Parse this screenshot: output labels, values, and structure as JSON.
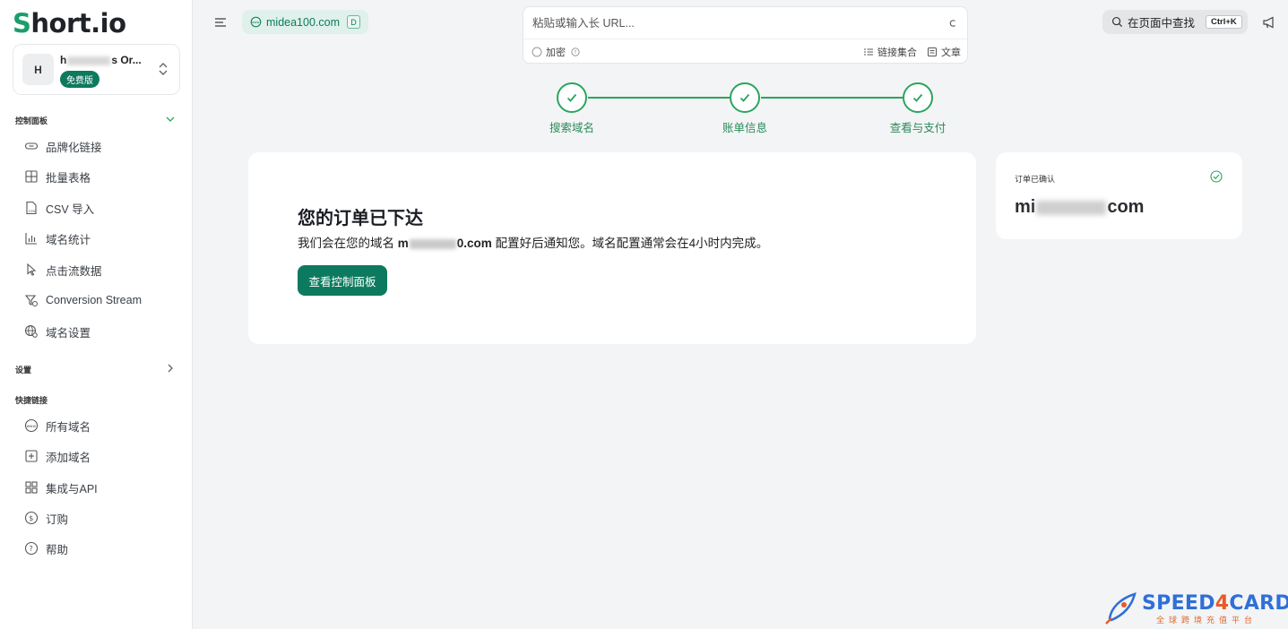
{
  "colors": {
    "brand": "#0d7a5f",
    "step_done": "#2aa55e",
    "chip_bg": "#dff1ea",
    "page_bg": "#f3f4f5"
  },
  "sidebar": {
    "logo_s": "S",
    "logo_rest": "hort.io",
    "org": {
      "avatar": "H",
      "name_start": "h",
      "name_end": "s Or...",
      "plan_badge": "免费版"
    },
    "sections": {
      "dashboard": "控制面板",
      "settings": "设置",
      "quick_links": "快捷链接"
    },
    "dashboard_items": [
      {
        "label": "品牌化链接",
        "icon": "link-icon"
      },
      {
        "label": "批量表格",
        "icon": "table-icon"
      },
      {
        "label": "CSV 导入",
        "icon": "csv-file-icon"
      },
      {
        "label": "域名统计",
        "icon": "bar-chart-icon"
      },
      {
        "label": "点击流数据",
        "icon": "cursor-icon"
      },
      {
        "label": "Conversion Stream",
        "icon": "funnel-icon"
      },
      {
        "label": "域名设置",
        "icon": "globe-gear-icon"
      }
    ],
    "quick_items": [
      {
        "label": "所有域名",
        "icon": "www-icon"
      },
      {
        "label": "添加域名",
        "icon": "plus-square-icon"
      },
      {
        "label": "集成与API",
        "icon": "integration-icon"
      },
      {
        "label": "订购",
        "icon": "dollar-circle-icon"
      },
      {
        "label": "帮助",
        "icon": "help-circle-icon"
      }
    ]
  },
  "topbar": {
    "domain_chip": "midea100.com",
    "domain_tag": "D",
    "url_placeholder": "粘贴或输入长 URL...",
    "encrypt_label": "加密",
    "link_collection": "链接集合",
    "article": "文章",
    "search_label": "在页面中查找",
    "search_shortcut": "Ctrl+K"
  },
  "stepper": {
    "steps": [
      "搜索域名",
      "账单信息",
      "查看与支付"
    ]
  },
  "main": {
    "title": "您的订单已下达",
    "msg_prefix": "我们会在您的域名",
    "domain_start": "m",
    "domain_end": "0.com",
    "msg_suffix": "配置好后通知您。域名配置通常会在4小时内完成。",
    "button": "查看控制面板"
  },
  "side_card": {
    "label": "订单已确认",
    "domain_start": "mi",
    "domain_end": "com"
  },
  "watermark": {
    "brand_a": "SPEED",
    "brand_b": "4",
    "brand_c": "CARD",
    "sub": "全球跨境充值平台"
  }
}
